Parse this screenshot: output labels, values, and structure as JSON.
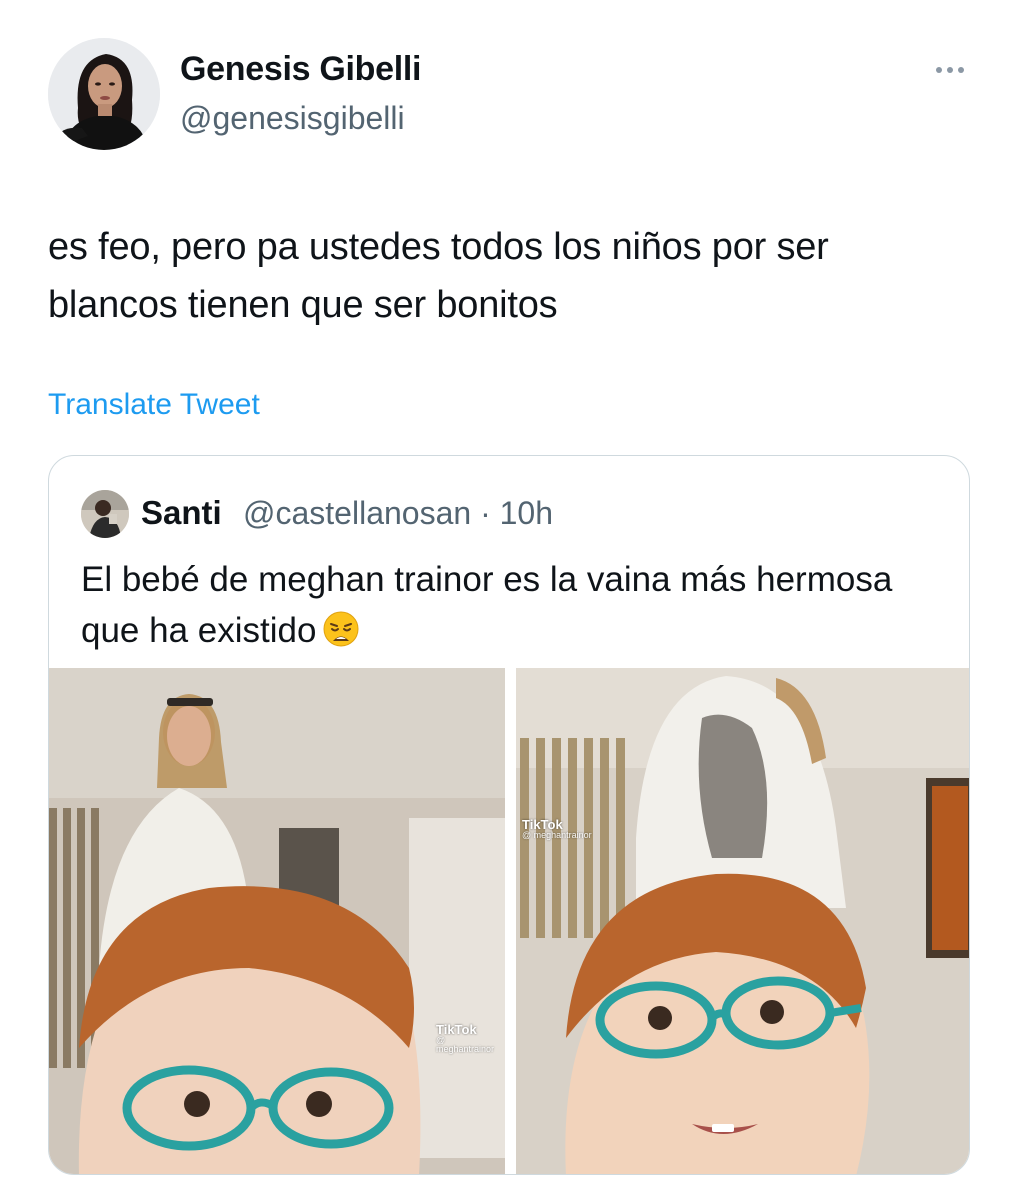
{
  "tweet": {
    "author": {
      "name": "Genesis Gibelli",
      "handle": "@genesisgibelli"
    },
    "text": "es feo, pero pa ustedes todos los niños por ser blancos tienen que ser bonitos",
    "translate_label": "Translate Tweet",
    "more_icon": "more-horizontal-icon"
  },
  "quoted_tweet": {
    "author": {
      "name": "Santi",
      "handle": "@castellanosan · 10h"
    },
    "text": "El bebé de meghan trainor es la vaina más hermosa que ha existido",
    "emoji": "weary-face-emoji",
    "media": [
      {
        "watermark_logo": "TikTok",
        "watermark_user": "@ meghantrainor"
      },
      {
        "watermark_logo": "TikTok",
        "watermark_user": "@ meghantrainor"
      }
    ]
  },
  "colors": {
    "accent": "#1d9bf0",
    "secondary_text": "#536471",
    "border": "#cfd9de"
  }
}
